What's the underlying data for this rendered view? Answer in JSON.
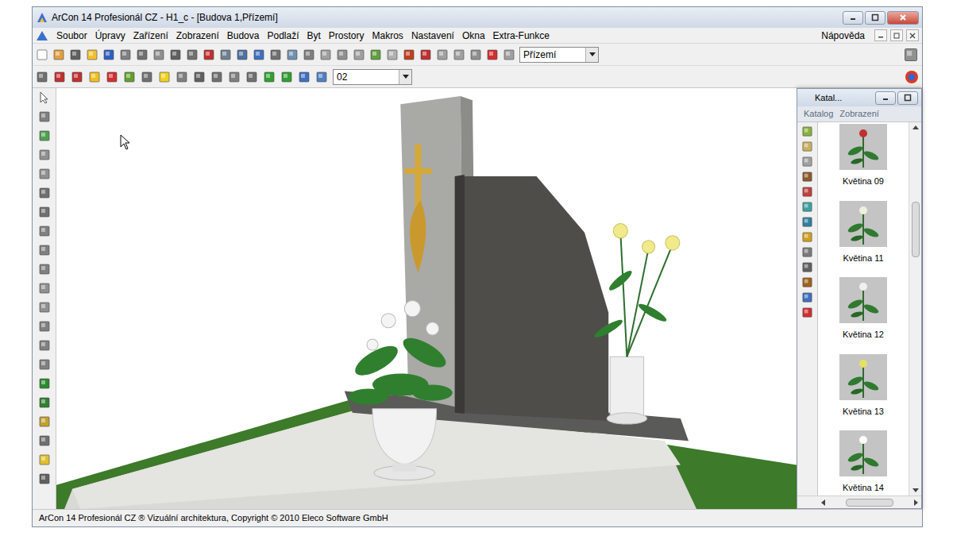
{
  "window": {
    "title": "ArCon 14 Profesionál CZ - H1_c - [Budova 1,Přízemí]"
  },
  "menu": [
    {
      "label": "Soubor"
    },
    {
      "label": "Úpravy"
    },
    {
      "label": "Zařízení"
    },
    {
      "label": "Zobrazení"
    },
    {
      "label": "Budova"
    },
    {
      "label": "Podlaží"
    },
    {
      "label": "Byt"
    },
    {
      "label": "Prostory"
    },
    {
      "label": "Makros"
    },
    {
      "label": "Nastavení"
    },
    {
      "label": "Okna"
    },
    {
      "label": "Extra-Funkce"
    }
  ],
  "help_menu": "Nápověda",
  "toolbar": {
    "floor_select": "Přízemí",
    "layer_select": "02"
  },
  "catalog": {
    "title": "Katal...",
    "menu": [
      "Katalog",
      "Zobrazení"
    ],
    "items": [
      {
        "label": "Květina 09"
      },
      {
        "label": "Květina 11"
      },
      {
        "label": "Květina 12"
      },
      {
        "label": "Květina 13"
      },
      {
        "label": "Květina 14"
      }
    ]
  },
  "status_bar": "ArCon 14 Profesionál CZ ® Vizuální architektura, Copyright © 2010 Eleco Software GmbH"
}
